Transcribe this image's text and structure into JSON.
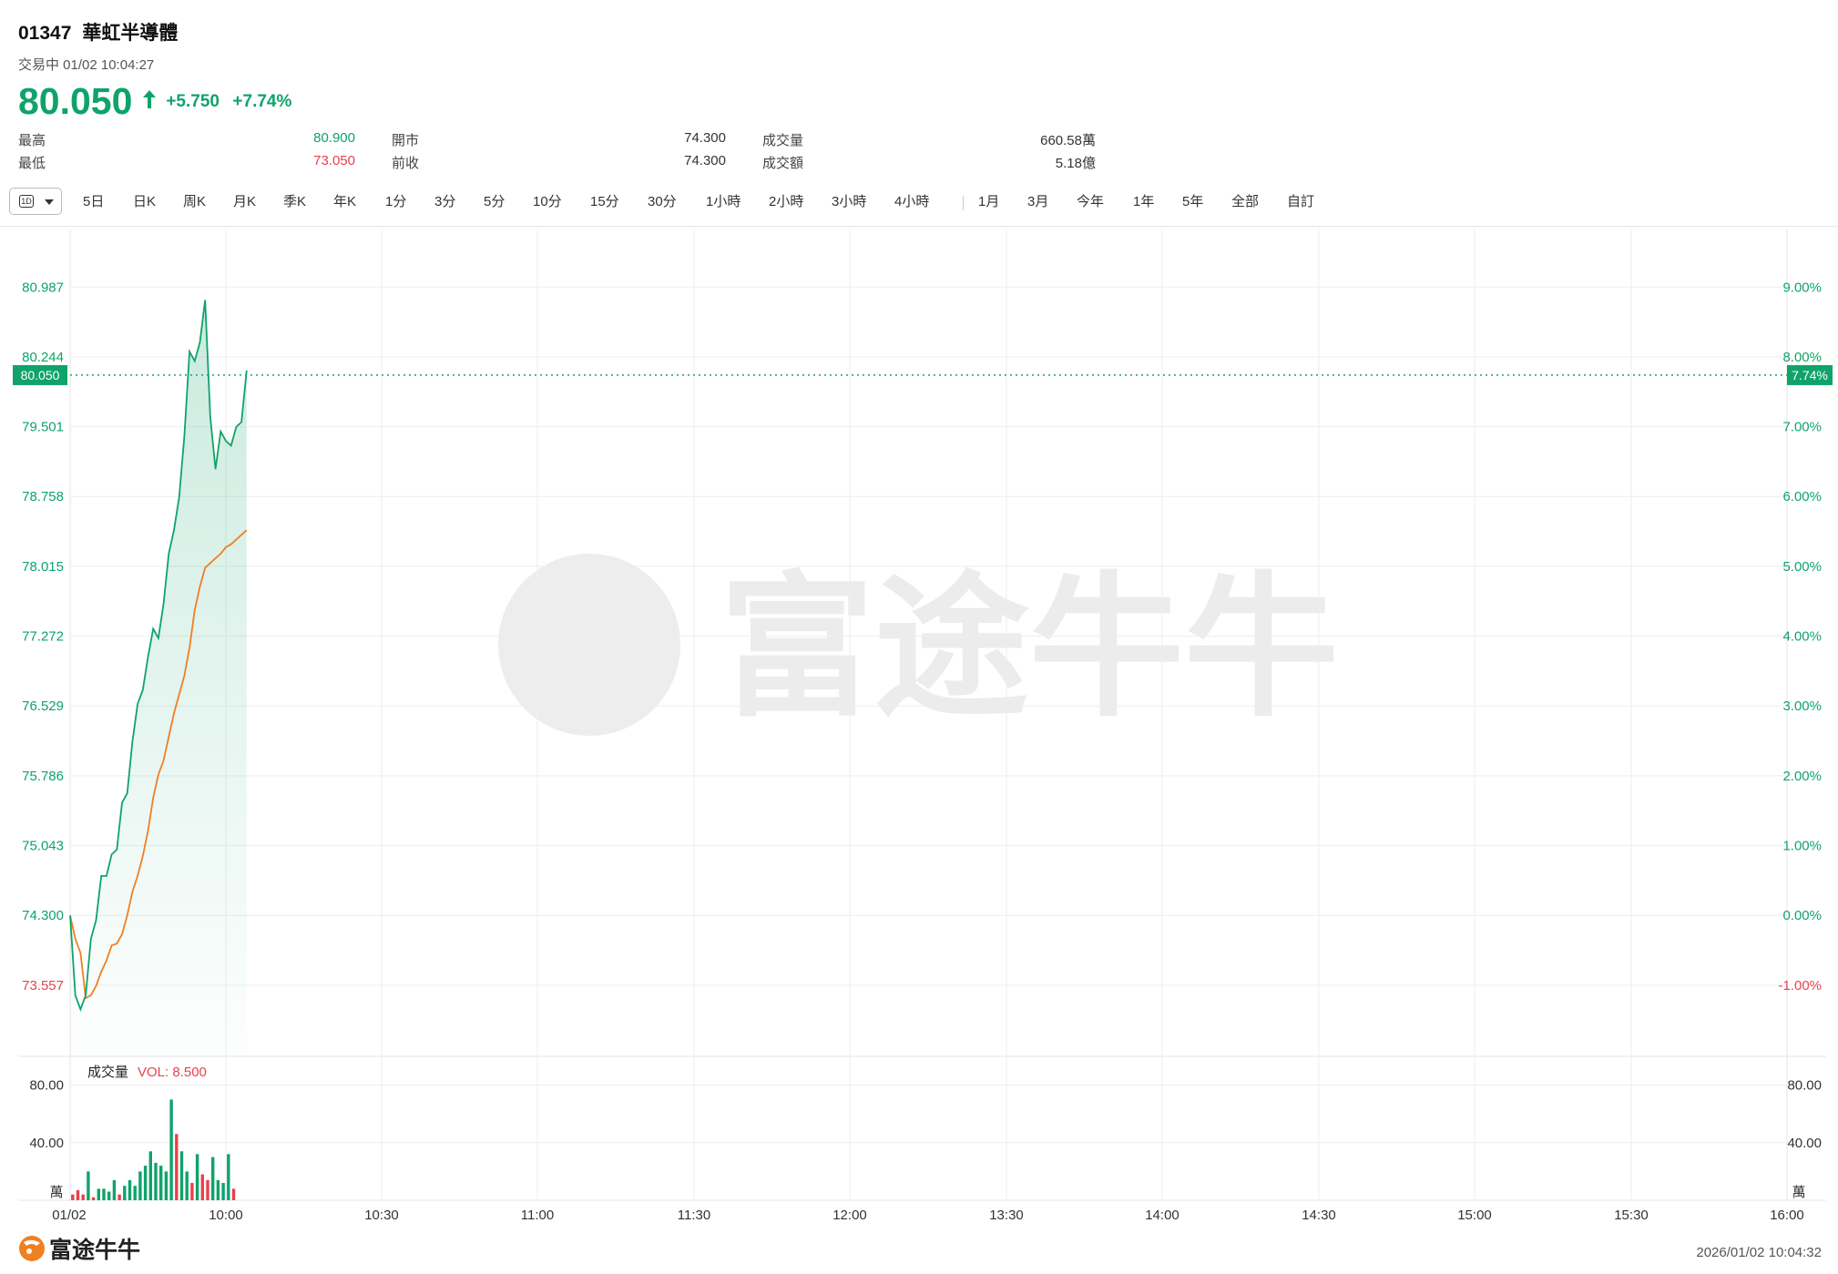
{
  "header": {
    "code": "01347",
    "name": "華虹半導體",
    "status": "交易中 01/02 10:04:27",
    "price": "80.050",
    "change": "+5.750",
    "change_pct": "+7.74%",
    "stats": [
      {
        "label": "最高",
        "value": "80.900",
        "color": "#0fa36b"
      },
      {
        "label": "最低",
        "value": "73.050",
        "color": "#e8414d"
      },
      {
        "label": "開市",
        "value": "74.300",
        "color": "#333333"
      },
      {
        "label": "前收",
        "value": "74.300",
        "color": "#333333"
      },
      {
        "label": "成交量",
        "value": "660.58萬",
        "color": "#333333"
      },
      {
        "label": "成交額",
        "value": "5.18億",
        "color": "#333333"
      }
    ]
  },
  "toolbar": {
    "selected": "1D",
    "periods": [
      "5日",
      "日K",
      "周K",
      "月K",
      "季K",
      "年K",
      "1分",
      "3分",
      "5分",
      "10分",
      "15分",
      "30分",
      "1小時",
      "2小時",
      "3小時",
      "4小時"
    ],
    "ranges": [
      "1月",
      "3月",
      "今年",
      "1年",
      "5年",
      "全部",
      "自訂"
    ]
  },
  "colors": {
    "up": "#0fa36b",
    "down": "#e8414d",
    "avg_line": "#f07f22",
    "grid": "#eeeeee",
    "axis_text": "#333333"
  },
  "chart_data": [
    {
      "type": "line",
      "title": "",
      "x_ticks": [
        "01/02",
        "10:00",
        "10:30",
        "11:00",
        "11:30",
        "12:00",
        "13:30",
        "14:00",
        "14:30",
        "15:00",
        "15:30",
        "16:00"
      ],
      "y_ticks_left": [
        "80.987",
        "80.244",
        "79.501",
        "78.758",
        "78.015",
        "77.272",
        "76.529",
        "75.786",
        "75.043",
        "74.300",
        "73.557"
      ],
      "y_ticks_right": [
        "9.00%",
        "8.00%",
        "7.00%",
        "6.00%",
        "5.00%",
        "4.00%",
        "3.00%",
        "2.00%",
        "1.00%",
        "0.00%",
        "-1.00%"
      ],
      "ylim": [
        72.8,
        81.6
      ],
      "prev_close": 74.3,
      "last_price_label": "80.050",
      "last_pct_label": "7.74%",
      "x_minutes": [
        0,
        1,
        2,
        3,
        4,
        5,
        6,
        7,
        8,
        9,
        10,
        11,
        12,
        13,
        14,
        15,
        16,
        17,
        18,
        19,
        20,
        21,
        22,
        23,
        24,
        25,
        26,
        27,
        28,
        29,
        30,
        31,
        32,
        33,
        34
      ],
      "series": [
        {
          "values": [
            74.3,
            73.45,
            73.3,
            73.45,
            74.05,
            74.25,
            74.72,
            74.72,
            74.95,
            75.0,
            75.5,
            75.6,
            76.15,
            76.55,
            76.7,
            77.05,
            77.35,
            77.25,
            77.62,
            78.15,
            78.4,
            78.75,
            79.4,
            80.3,
            80.2,
            80.4,
            80.85,
            79.6,
            79.05,
            79.45,
            79.35,
            79.3,
            79.5,
            79.55,
            80.1
          ]
        },
        {
          "values": [
            74.3,
            74.05,
            73.9,
            73.42,
            73.45,
            73.55,
            73.7,
            73.82,
            73.98,
            74.0,
            74.1,
            74.3,
            74.55,
            74.72,
            74.93,
            75.2,
            75.55,
            75.8,
            75.95,
            76.2,
            76.45,
            76.65,
            76.85,
            77.15,
            77.55,
            77.8,
            78.0,
            78.05,
            78.1,
            78.15,
            78.22,
            78.25,
            78.3,
            78.35,
            78.4
          ]
        }
      ]
    },
    {
      "type": "bar",
      "title": "成交量",
      "vol_label": "VOL: 8.500",
      "unit": "萬",
      "y_ticks": [
        "80.00",
        "40.00"
      ],
      "ylim": [
        0,
        100
      ],
      "values": [
        4,
        7,
        4,
        20,
        2,
        8,
        8,
        6,
        14,
        4,
        10,
        14,
        10,
        20,
        24,
        34,
        26,
        24,
        20,
        70,
        46,
        34,
        20,
        12,
        32,
        18,
        14,
        30,
        14,
        12,
        32,
        8
      ],
      "directions": [
        "d",
        "d",
        "d",
        "u",
        "d",
        "u",
        "u",
        "u",
        "u",
        "d",
        "u",
        "u",
        "u",
        "u",
        "u",
        "u",
        "u",
        "u",
        "u",
        "u",
        "d",
        "u",
        "u",
        "d",
        "u",
        "d",
        "d",
        "u",
        "u",
        "u",
        "u",
        "d"
      ]
    }
  ],
  "footer": {
    "brand": "富途牛牛",
    "timestamp": "2026/01/02 10:04:32"
  },
  "watermark": "富途牛牛"
}
